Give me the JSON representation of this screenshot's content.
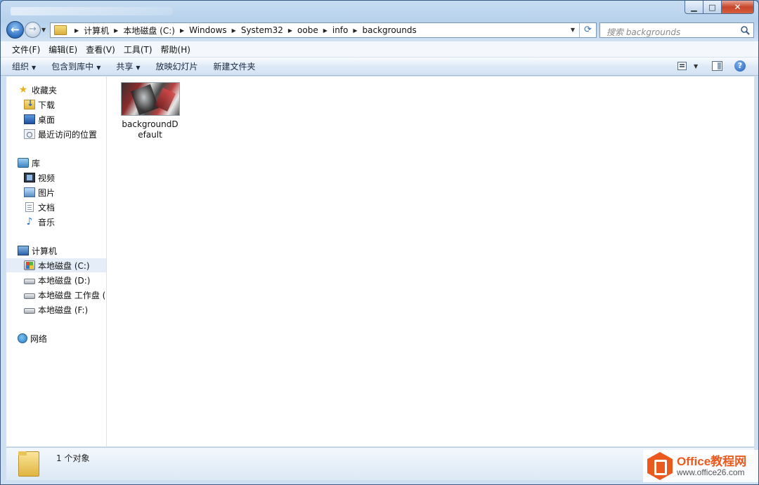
{
  "window": {
    "controls": {
      "minimize": "▁",
      "maximize": "□",
      "close": "✕"
    }
  },
  "nav": {
    "breadcrumbs": [
      "计算机",
      "本地磁盘 (C:)",
      "Windows",
      "System32",
      "oobe",
      "info",
      "backgrounds"
    ],
    "search_placeholder": "搜索 backgrounds"
  },
  "menu": [
    "文件(F)",
    "编辑(E)",
    "查看(V)",
    "工具(T)",
    "帮助(H)"
  ],
  "commands": {
    "organize": "组织",
    "include_library": "包含到库中",
    "share": "共享",
    "slideshow": "放映幻灯片",
    "new_folder": "新建文件夹",
    "help": "?"
  },
  "sidebar": {
    "favorites": "收藏夹",
    "downloads": "下载",
    "desktop": "桌面",
    "recent": "最近访问的位置",
    "libraries": "库",
    "videos": "视频",
    "pictures": "图片",
    "documents": "文档",
    "music": "音乐",
    "computer": "计算机",
    "drive_c": "本地磁盘 (C:)",
    "drive_d": "本地磁盘 (D:)",
    "drive_e": "本地磁盘 工作盘 (E:",
    "drive_f": "本地磁盘 (F:)",
    "network": "网络"
  },
  "files": [
    {
      "name": "backgroundDefault",
      "icon": "image-thumbnail"
    }
  ],
  "status": {
    "count": "1 个对象"
  },
  "watermark": {
    "title": "Office教程网",
    "url": "www.office26.com"
  },
  "colors": {
    "accent": "#3b6fb0",
    "watermark": "#ea5a1e",
    "selection": "#e5eef8"
  }
}
